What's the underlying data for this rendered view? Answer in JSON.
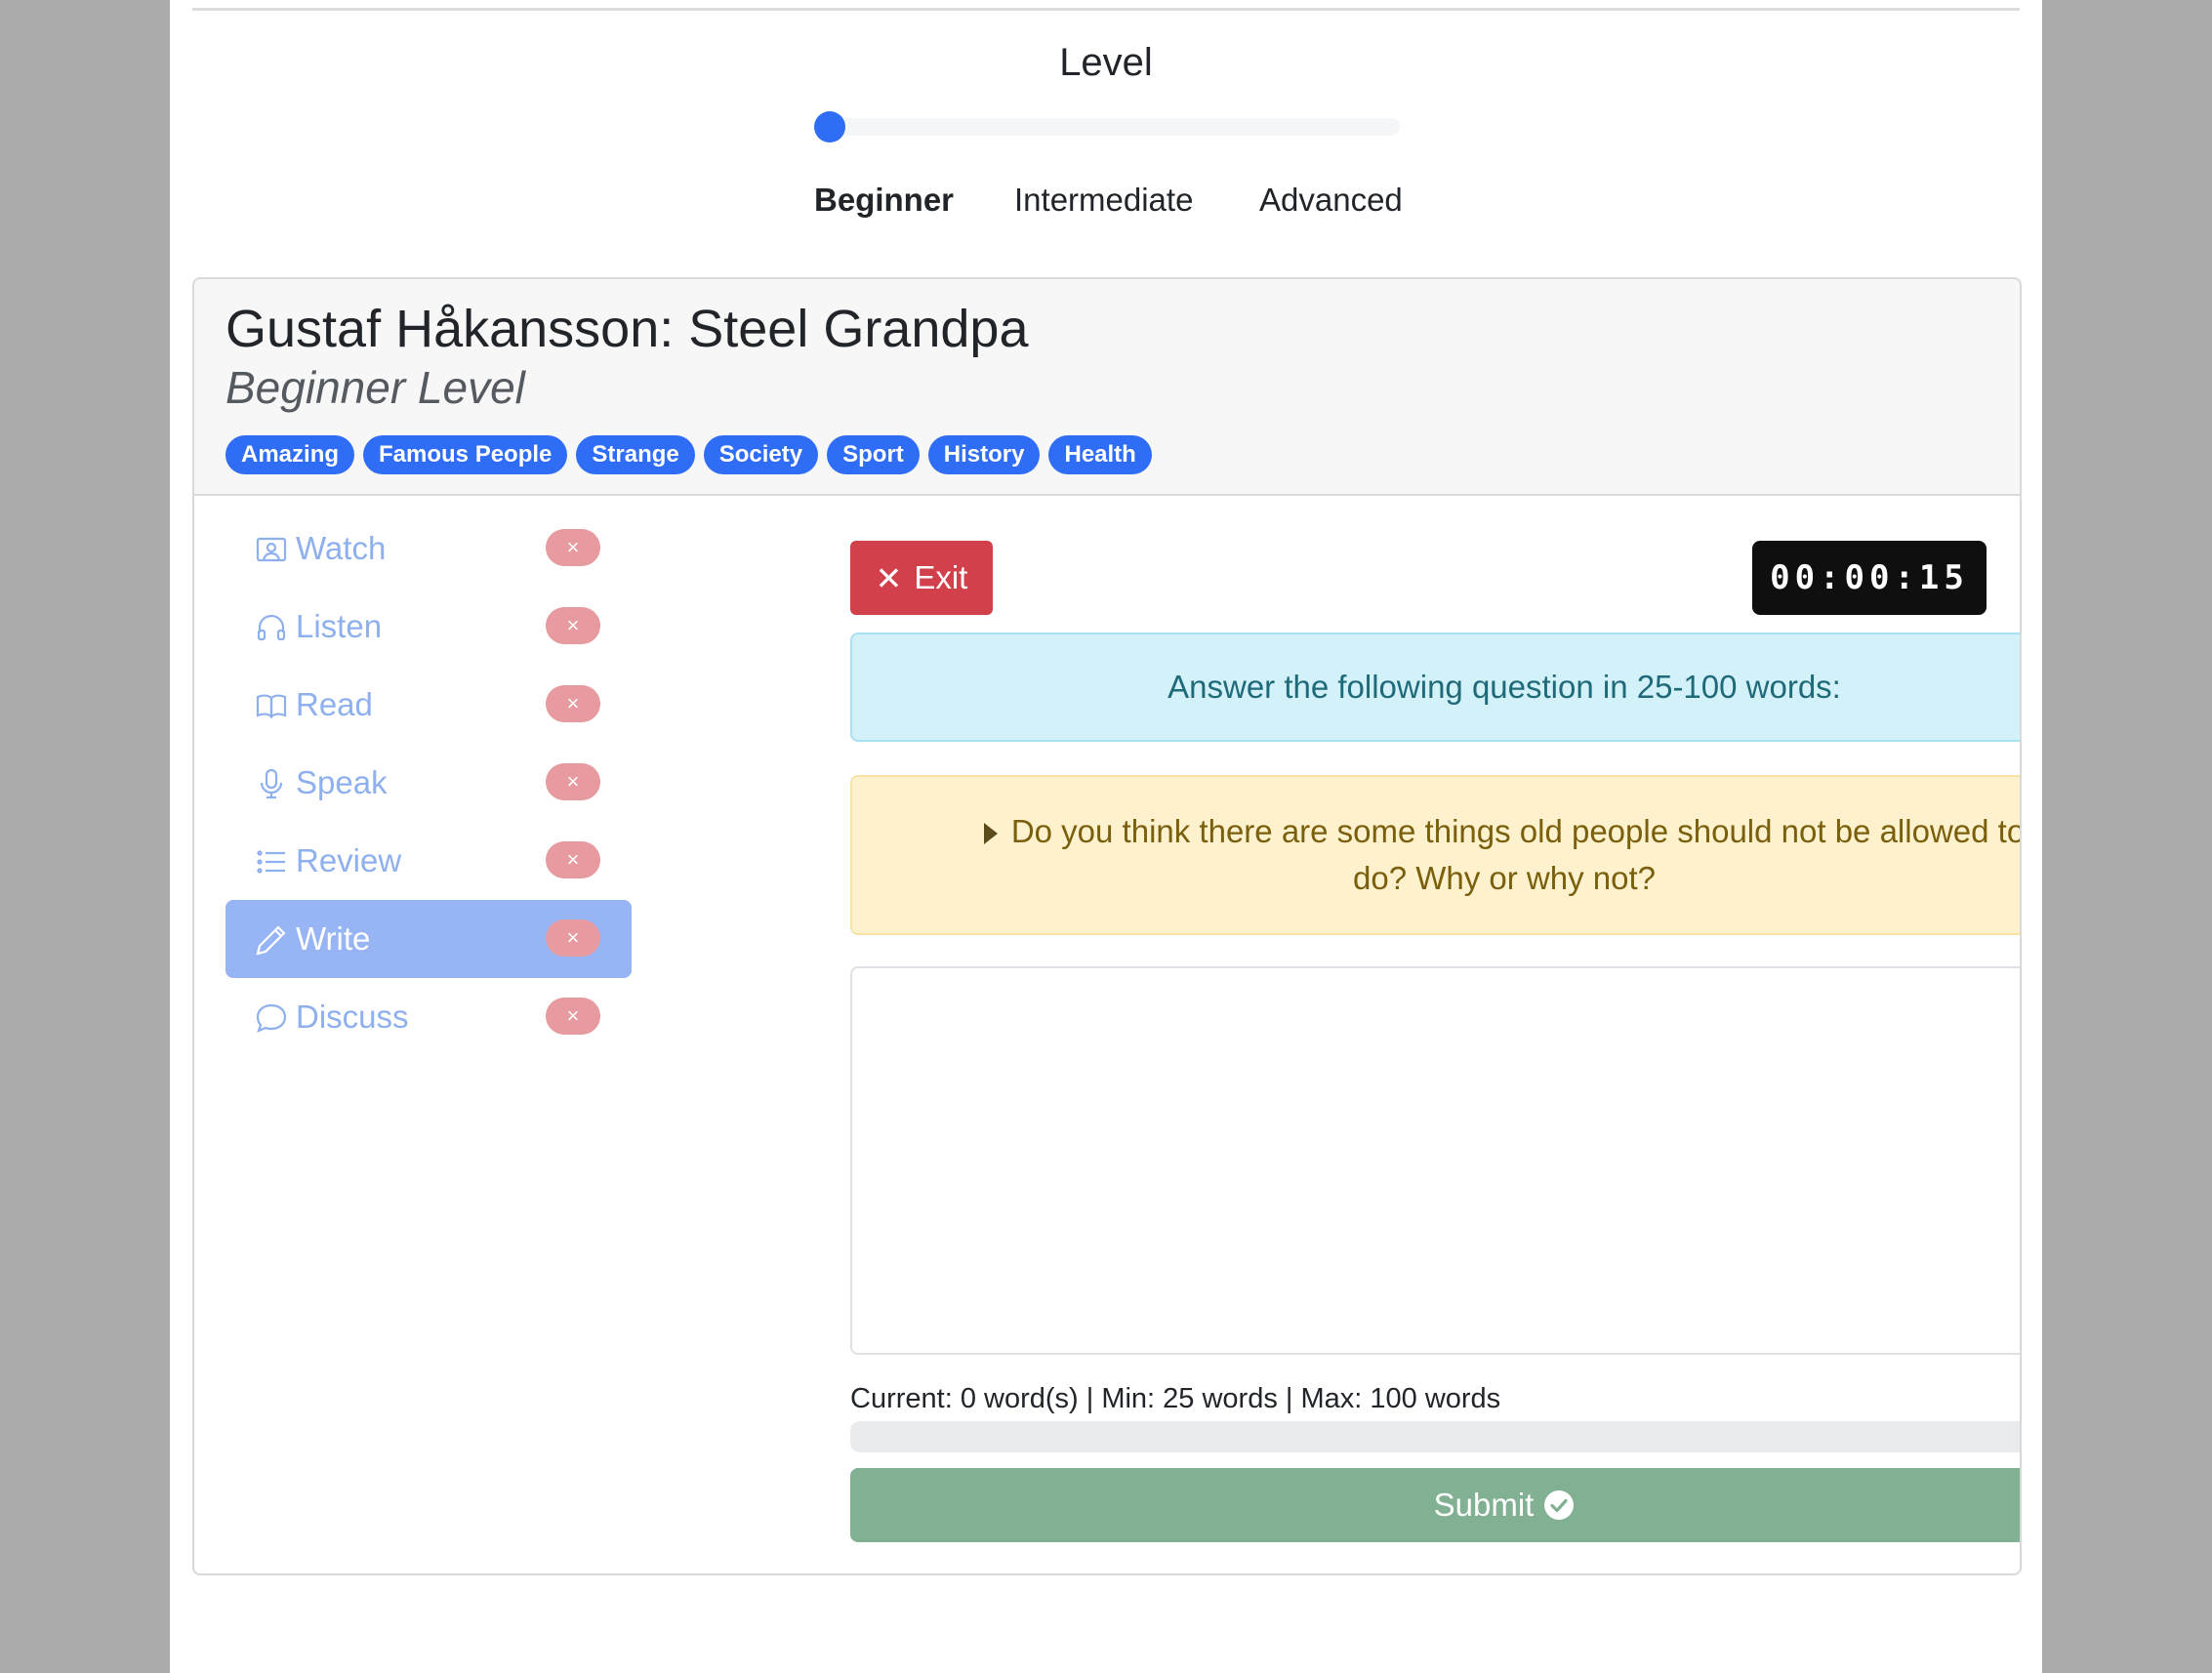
{
  "level": {
    "title": "Level",
    "value": 0,
    "options": [
      "Beginner",
      "Intermediate",
      "Advanced"
    ],
    "selected": "Beginner"
  },
  "lesson": {
    "title": "Gustaf Håkansson: Steel Grandpa",
    "subtitle": "Beginner Level",
    "tags": [
      "Amazing",
      "Famous People",
      "Strange",
      "Society",
      "Sport",
      "History",
      "Health"
    ]
  },
  "sidebar": {
    "items": [
      {
        "label": "Watch",
        "icon": "video-icon",
        "badge": "×"
      },
      {
        "label": "Listen",
        "icon": "headphones-icon",
        "badge": "×"
      },
      {
        "label": "Read",
        "icon": "book-icon",
        "badge": "×"
      },
      {
        "label": "Speak",
        "icon": "microphone-icon",
        "badge": "×"
      },
      {
        "label": "Review",
        "icon": "list-icon",
        "badge": "×"
      },
      {
        "label": "Write",
        "icon": "pencil-icon",
        "badge": "×",
        "active": true
      },
      {
        "label": "Discuss",
        "icon": "chat-bubble-icon",
        "badge": "×"
      }
    ]
  },
  "main": {
    "exit_label": "Exit",
    "timer": "00:00:15",
    "instruction": "Answer the following question in 25-100 words:",
    "question": "Do you think there are some things old people should not be allowed to do? Why or why not?",
    "answer_value": "",
    "word_count": "Current: 0 word(s) | Min: 25 words | Max: 100 words",
    "progress_percent": 0,
    "submit_label": "Submit"
  },
  "colors": {
    "primary": "#2f6df6",
    "danger": "#d1404b",
    "success_disabled": "#82b093",
    "info_bg": "#d3f1f9",
    "warning_bg": "#fdf1ce"
  }
}
